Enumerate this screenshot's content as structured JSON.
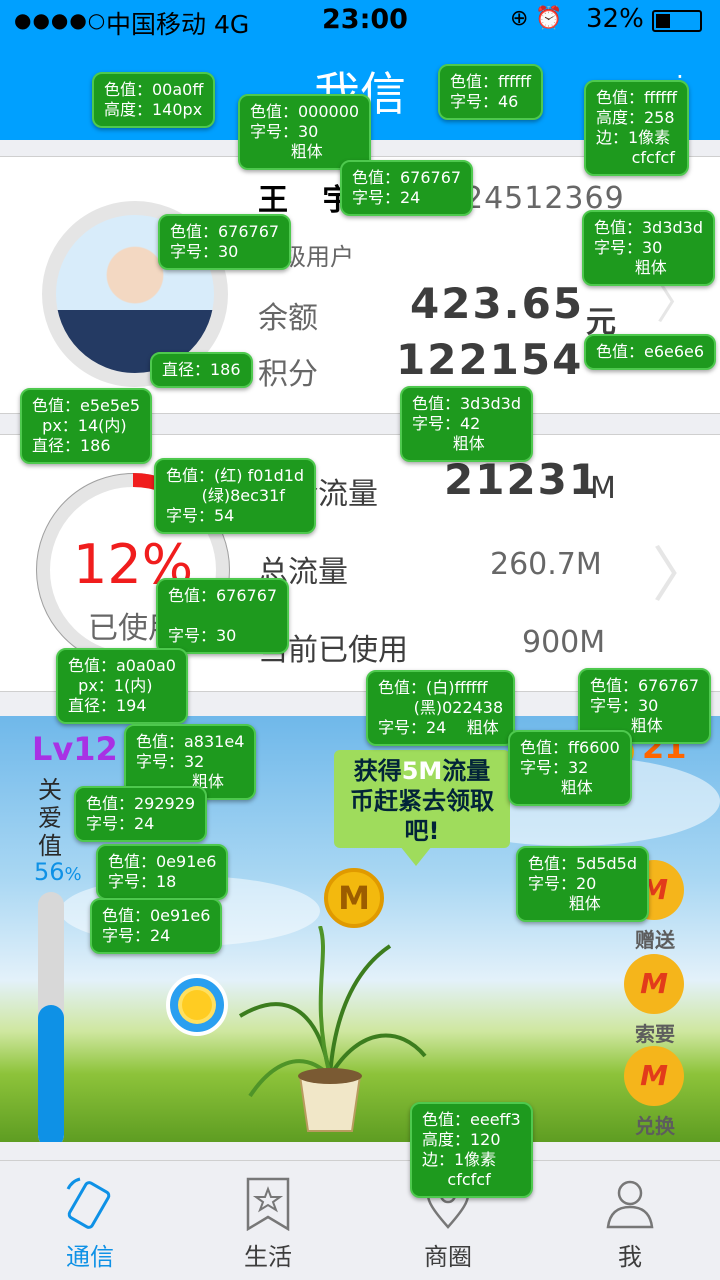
{
  "status_bar": {
    "signal": "●●●●○",
    "carrier": "中国移动  4G",
    "time": "23:00",
    "icons": "⊕ ⏰",
    "battery": "32%"
  },
  "header": {
    "title": "我信"
  },
  "account": {
    "name": "王  宇",
    "phone": "24512369",
    "level": "星级用户",
    "balance_label": "余额",
    "balance_value": "423.65",
    "balance_unit": "元",
    "points_label": "积分",
    "points_value": "122154"
  },
  "traffic": {
    "used_percent_label": "12%",
    "used_fraction": 0.12,
    "used_label": "已使用",
    "remaining_label": "剩余流量",
    "remaining_value": "21231",
    "remaining_unit": "M",
    "total_label": "总流量",
    "total_value": "260.7M",
    "current_label": "当前已使用",
    "current_value": "900M"
  },
  "garden": {
    "level": "Lv12",
    "care_label": "关爱值",
    "care_percent_num": "56",
    "care_percent_sign": "%",
    "care_fraction": 0.56,
    "coin_count": "21",
    "bubble_pre": "获得",
    "bubble_highlight": "5M",
    "bubble_post": "流量币赶紧去领取吧!",
    "coin_letter": "M",
    "actions": [
      {
        "label": "赠送",
        "icon": "M"
      },
      {
        "label": "索要",
        "icon": "M"
      },
      {
        "label": "兑换",
        "icon": "M"
      }
    ]
  },
  "tabs": [
    {
      "label": "通信",
      "icon": "phone-icon",
      "active": true
    },
    {
      "label": "生活",
      "icon": "star-icon",
      "active": false
    },
    {
      "label": "商圈",
      "icon": "location-icon",
      "active": false
    },
    {
      "label": "我",
      "icon": "person-icon",
      "active": false
    }
  ],
  "annotations": {
    "header": "色值：00a0ff\n高度：140px",
    "title": "色值：ffffff\n字号：46",
    "card1": "色值：ffffff\n高度：258\n边：1像素\n       cfcfcf",
    "name": "色值：000000\n字号：30\n        粗体",
    "phone": "色值：676767\n字号：24",
    "labels": "色值：676767\n字号：30",
    "values": "色值：3d3d3d\n字号：30\n        粗体",
    "chevron": "色值：e6e6e6",
    "avatar_diam": "直径：186",
    "avatar_ring": "色值：e5e5e5\n  px：14(内)\n直径：186",
    "big_values": "色值：3d3d3d\n字号：42\n        粗体",
    "pct": "色值：(红) f01d1d\n       (绿)8ec31f\n字号：54",
    "used_label": "色值：676767\n\n字号：30",
    "ring": "色值：a0a0a0\n  px：1(内)\n直径：194",
    "bubble": "色值：(白)ffffff\n       (黑)022438\n字号：24    粗体",
    "traffic_values": "色值：676767\n字号：30\n        粗体",
    "lv": "色值：a831e4\n字号：32\n           粗体",
    "coin_count": "色值：ff6600\n字号：32\n        粗体",
    "care": "色值：292929\n字号：24",
    "care_pct": "色值：0e91e6\n字号：18",
    "bar": "色值：0e91e6\n字号：24",
    "actions": "色值：5d5d5d\n字号：20\n        粗体",
    "tabbar": "色值：eeeff3\n高度：120\n边：1像素\n     cfcfcf"
  }
}
